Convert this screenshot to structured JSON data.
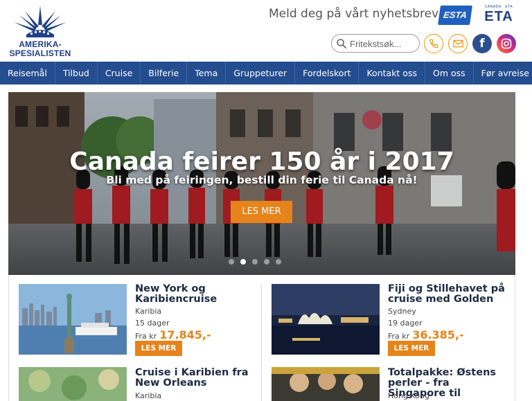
{
  "header": {
    "logo_line1": "AMERIKA-",
    "logo_line2": "SPESIALISTEN",
    "newsletter": "Meld deg på vårt nyhetsbrev her!",
    "esta_label": "ESTA",
    "eta_small": "CANADA · ETA",
    "eta_label": "ETA",
    "search_placeholder": "Fritekstsøk...",
    "facebook_glyph": "f"
  },
  "nav": {
    "items": [
      "Reisemål",
      "Tilbud",
      "Cruise",
      "Bilferie",
      "Tema",
      "Gruppeturer",
      "Fordelskort",
      "Kontakt oss",
      "Om oss",
      "Før avreise"
    ]
  },
  "hero": {
    "title": "Canada feirer 150 år i 2017",
    "subtitle": "Bli med på feiringen, bestill din ferie til Canada nå!",
    "button": "LES MER",
    "slide_count": 5,
    "active_slide": 1
  },
  "cards": [
    {
      "title": "New York og Karibiencruise",
      "region": "Karibia",
      "days": "15 dager",
      "price_prefix": "Fra kr",
      "price": "17.845,-",
      "button": "LES MER"
    },
    {
      "title": "Fiji og Stillehavet på cruise med Golden",
      "region": "Sydney",
      "days": "19 dager",
      "price_prefix": "Fra kr",
      "price": "36.385,-",
      "button": "LES MER"
    },
    {
      "title": "Cruise i Karibien fra New Orleans",
      "region": "Karibia"
    },
    {
      "title": "Totalpakke: Østens perler - fra Singapore til",
      "region": "Hong Kong"
    }
  ],
  "colors": {
    "nav_bg": "#244d8f",
    "accent_orange": "#e6831a",
    "brand_blue": "#1f3f86"
  }
}
